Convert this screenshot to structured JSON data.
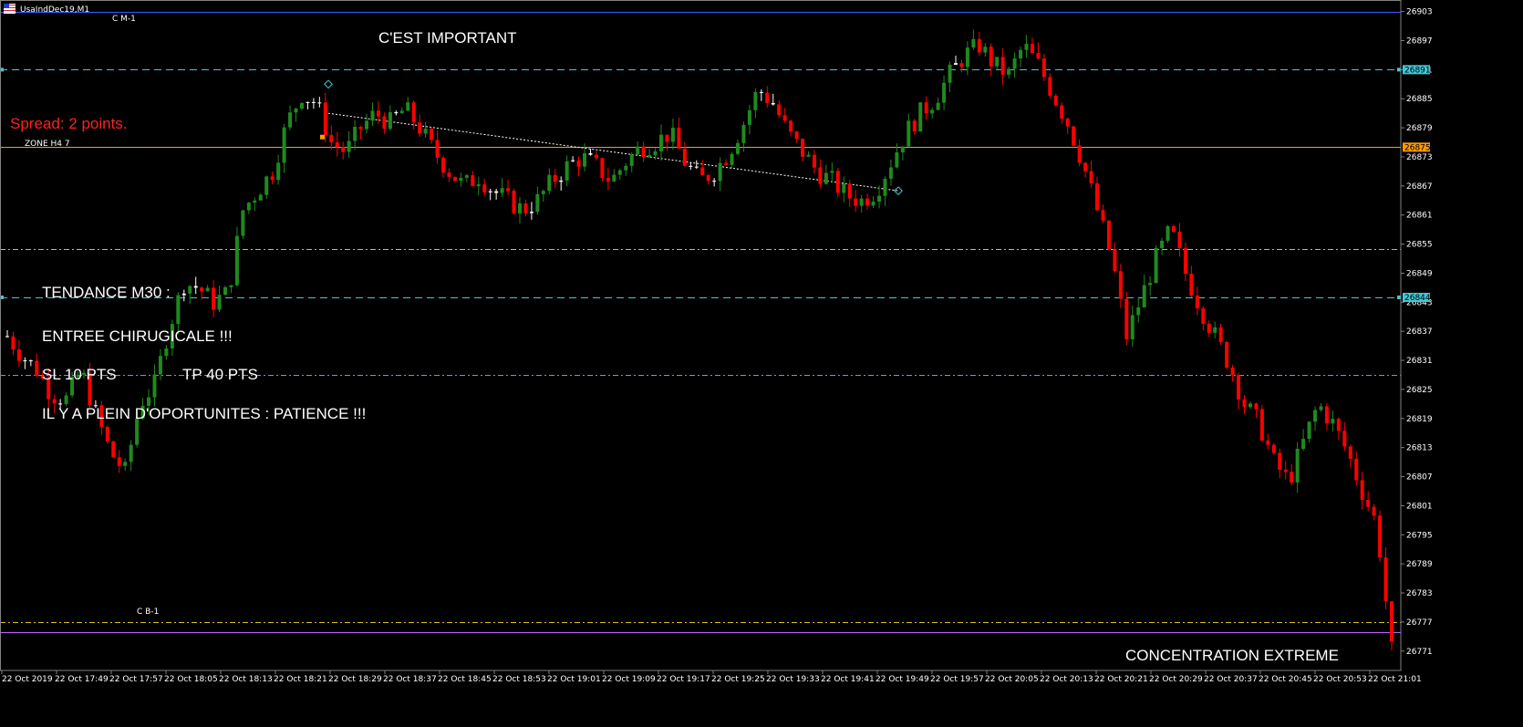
{
  "window": {
    "symbol_label": "UsaIndDec19,M1",
    "flag_icon": "flag-icon"
  },
  "labels": {
    "cm1": "C M-1",
    "cb1": "C B-1",
    "zone_h4": "ZONE H4 7",
    "important": "C'EST IMPORTANT",
    "spread": "Spread: 2 points.",
    "tendance": "TENDANCE M30 :",
    "entree": "ENTREE CHIRUGICALE !!!",
    "sl": "SL  10 PTS",
    "tp": "TP 40 PTS",
    "opportunites": "IL Y A PLEIN D'OPORTUNITES : PATIENCE !!!",
    "concentration": "CONCENTRATION EXTREME"
  },
  "colors": {
    "background": "#000000",
    "bull": "#1e8a1e",
    "bear": "#ff0000",
    "doji": "#ffffff",
    "cyan_line": "#40c8d8",
    "orange_line": "#ff9a00",
    "purple_line": "#b070ff",
    "yellow_dash": "#d8c020",
    "blue_line": "#3a5aff",
    "spread_text": "#ff2020"
  },
  "chart_data": {
    "type": "candlestick",
    "symbol": "UsaIndDec19",
    "timeframe": "M1",
    "y_ticks": [
      26903,
      26897,
      26891,
      26885,
      26879,
      26873,
      26867,
      26861,
      26855,
      26849,
      26843,
      26837,
      26831,
      26825,
      26819,
      26813,
      26807,
      26801,
      26795,
      26789,
      26783,
      26777,
      26771
    ],
    "ylim": [
      26767,
      26905
    ],
    "x_ticks": [
      "22 Oct 2019",
      "22 Oct 17:49",
      "22 Oct 17:57",
      "22 Oct 18:05",
      "22 Oct 18:13",
      "22 Oct 18:21",
      "22 Oct 18:29",
      "22 Oct 18:37",
      "22 Oct 18:45",
      "22 Oct 18:53",
      "22 Oct 19:01",
      "22 Oct 19:09",
      "22 Oct 19:17",
      "22 Oct 19:25",
      "22 Oct 19:33",
      "22 Oct 19:41",
      "22 Oct 19:49",
      "22 Oct 19:57",
      "22 Oct 20:05",
      "22 Oct 20:13",
      "22 Oct 20:21",
      "22 Oct 20:29",
      "22 Oct 20:37",
      "22 Oct 20:45",
      "22 Oct 20:53",
      "22 Oct 21:01"
    ],
    "price_markers": [
      {
        "value": 26891,
        "label": "26891",
        "color": "#40c8d8",
        "style": "dashed"
      },
      {
        "value": 26875,
        "label": "26875",
        "color": "#ff9a00",
        "style": "solid"
      },
      {
        "value": 26844,
        "label": "26844",
        "color": "#40c8d8",
        "style": "dashed"
      }
    ],
    "levels": [
      {
        "value": 26903,
        "color": "#3a5aff",
        "style": "solid"
      },
      {
        "value": 26891,
        "color": "#40c8d8",
        "style": "dashed"
      },
      {
        "value": 26875,
        "color": "#ff9a00",
        "style": "solid"
      },
      {
        "value": 26854,
        "color": "#d8c020",
        "style": "dashdot"
      },
      {
        "value": 26844,
        "color": "#40c8d8",
        "style": "dashed"
      },
      {
        "value": 26828,
        "color": "#b070ff",
        "style": "dashdot"
      },
      {
        "value": 26777,
        "color": "#d8c020",
        "style": "dashdot"
      },
      {
        "value": 26775,
        "color": "#c060ff",
        "style": "solid"
      }
    ],
    "close_path": [
      26836,
      26832,
      26829,
      26824,
      26823,
      26829,
      26820,
      26812,
      26808,
      26822,
      26826,
      26838,
      26847,
      26846,
      26843,
      26845,
      26862,
      26866,
      26870,
      26880,
      26886,
      26884,
      26876,
      26874,
      26879,
      26882,
      26880,
      26883,
      26879,
      26874,
      26870,
      26867,
      26869,
      26866,
      26864,
      26862,
      26864,
      26868,
      26871,
      26873,
      26871,
      26868,
      26872,
      26875,
      26876,
      26878,
      26872,
      26868,
      26870,
      26874,
      26880,
      26887,
      26884,
      26878,
      26874,
      26870,
      26868,
      26865,
      26864,
      26866,
      26872,
      26878,
      26882,
      26885,
      26890,
      26894,
      26896,
      26892,
      26890,
      26896,
      26892,
      26886,
      26880,
      26872,
      26862,
      26852,
      26836,
      26844,
      26852,
      26858,
      26849,
      26842,
      26836,
      26830,
      26822,
      26818,
      26810,
      26806,
      26814,
      26822,
      26818,
      26812,
      26804,
      26797,
      26771
    ]
  }
}
